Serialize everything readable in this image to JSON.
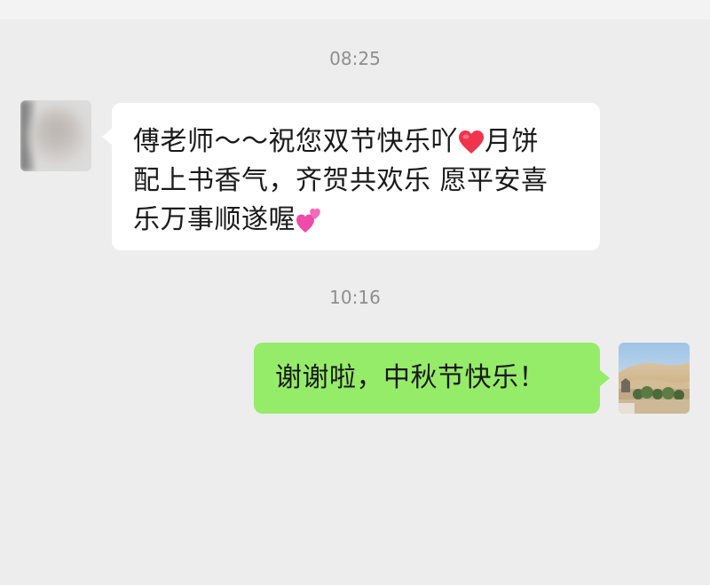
{
  "chat": {
    "messages": [
      {
        "timestamp": "08:25",
        "direction": "incoming",
        "line1": "傅老师～～祝您双节快乐吖",
        "line1_after_emoji": "月饼",
        "line2": "配上书香气，齐贺共欢乐 愿平安喜",
        "line3": "乐万事顺遂喔",
        "emojis": [
          "red-heart",
          "two-pink-hearts"
        ]
      },
      {
        "timestamp": "10:16",
        "direction": "outgoing",
        "text": "谢谢啦，中秋节快乐！"
      }
    ]
  },
  "colors": {
    "background": "#ededed",
    "incoming_bubble": "#ffffff",
    "outgoing_bubble": "#95ec69",
    "timestamp_text": "#8e8e8e",
    "message_text": "#1a1a1a"
  },
  "icons": {
    "incoming_avatar": "blurred-profile-photo",
    "outgoing_avatar": "desert-landscape-photo"
  }
}
